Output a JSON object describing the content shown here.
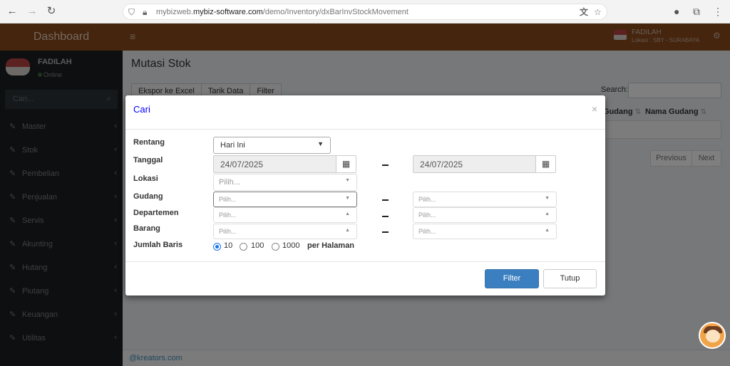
{
  "browser": {
    "url_prefix": "mybizweb.",
    "url_domain": "mybiz-software.com",
    "url_path": "/demo/Inventory/dxBarInvStockMovement"
  },
  "header": {
    "brand": "Dashboard",
    "user_name": "FADILAH",
    "user_location": "Lokasi : SBY - SURABAYA"
  },
  "sidebar": {
    "user_name": "FADILAH",
    "status": "Online",
    "search_placeholder": "Cari...",
    "items": [
      {
        "label": "Master"
      },
      {
        "label": "Stok"
      },
      {
        "label": "Pembelian"
      },
      {
        "label": "Penjualan"
      },
      {
        "label": "Servis"
      },
      {
        "label": "Akunting"
      },
      {
        "label": "Hutang"
      },
      {
        "label": "Piutang"
      },
      {
        "label": "Keuangan"
      },
      {
        "label": "Utilitas"
      }
    ]
  },
  "page": {
    "title": "Mutasi Stok",
    "toolbar": {
      "export_label": "Ekspor ke Excel",
      "pull_label": "Tarik Data",
      "filter_label": "Filter"
    },
    "search_label": "Search:",
    "table_headers": [
      "Gudang",
      "Nama Gudang"
    ],
    "pagination": {
      "previous": "Previous",
      "next": "Next"
    },
    "footer": "@kreators.com"
  },
  "modal": {
    "title": "Cari",
    "close": "×",
    "labels": {
      "rentang": "Rentang",
      "tanggal": "Tanggal",
      "lokasi": "Lokasi",
      "gudang": "Gudang",
      "departemen": "Departemen",
      "barang": "Barang",
      "jumlah_baris": "Jumlah Baris"
    },
    "rentang_value": "Hari Ini",
    "date_from": "24/07/2025",
    "date_to": "24/07/2025",
    "lokasi_placeholder": "Pilih...",
    "picker_placeholder": "Pilih...",
    "rows_options": [
      "10",
      "100",
      "1000"
    ],
    "rows_selected": "10",
    "per_page_label": "per Halaman",
    "filter_button": "Filter",
    "close_button": "Tutup"
  },
  "icons": {
    "calendar": "calendar-icon",
    "caret": "caret-down-icon",
    "edit": "edit-icon"
  },
  "colors": {
    "header_bg": "#8a4a1c",
    "sidebar_bg": "#1a1f21",
    "primary": "#3c7fc0",
    "modal_title": "#0000ff"
  }
}
